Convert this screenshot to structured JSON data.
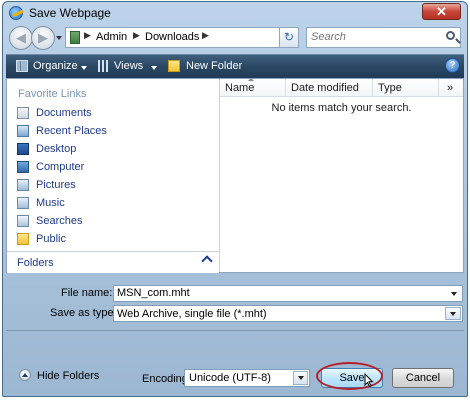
{
  "window": {
    "title": "Save Webpage",
    "close_label": "✕"
  },
  "nav": {
    "breadcrumb": [
      "Admin",
      "Downloads"
    ],
    "search_placeholder": "Search",
    "refresh_glyph": "↻"
  },
  "toolbar": {
    "organize": "Organize",
    "views": "Views",
    "new_folder": "New Folder",
    "help_glyph": "?"
  },
  "favorites": {
    "header": "Favorite Links",
    "items": [
      {
        "label": "Documents",
        "icon": "documents-icon"
      },
      {
        "label": "Recent Places",
        "icon": "recent-places-icon"
      },
      {
        "label": "Desktop",
        "icon": "desktop-icon"
      },
      {
        "label": "Computer",
        "icon": "computer-icon"
      },
      {
        "label": "Pictures",
        "icon": "pictures-icon"
      },
      {
        "label": "Music",
        "icon": "music-icon"
      },
      {
        "label": "Searches",
        "icon": "searches-icon"
      },
      {
        "label": "Public",
        "icon": "public-icon"
      }
    ],
    "folders_label": "Folders"
  },
  "file_list": {
    "columns": [
      "Name",
      "Date modified",
      "Type"
    ],
    "overflow_glyph": "»",
    "empty_message": "No items match your search."
  },
  "form": {
    "filename_label": "File name:",
    "filename_value": "MSN_com.mht",
    "savetype_label": "Save as type:",
    "savetype_value": "Web Archive, single file (*.mht)"
  },
  "footer": {
    "hide_folders": "Hide Folders",
    "encoding_label": "Encoding:",
    "encoding_value": "Unicode (UTF-8)",
    "save": "Save",
    "cancel": "Cancel"
  },
  "colors": {
    "toolbar_bg": "#2a4764",
    "link_blue": "#1e3a8a",
    "highlight_ring": "#b5212a"
  }
}
